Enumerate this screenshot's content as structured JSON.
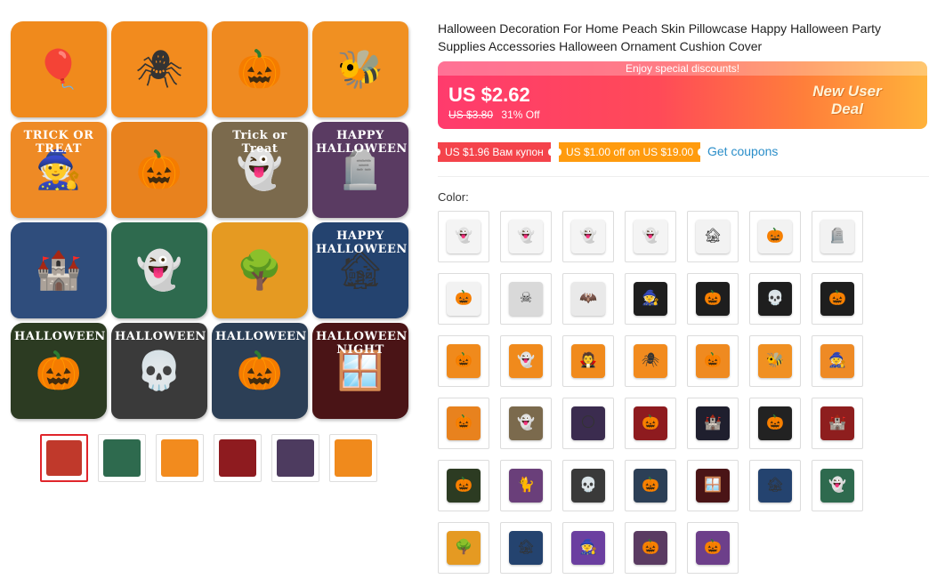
{
  "product": {
    "title": "Halloween Decoration For Home Peach Skin Pillowcase Happy Halloween Party Supplies Accessories Halloween Ornament Cushion Cover"
  },
  "price_banner": {
    "promo_strip": "Enjoy special discounts!",
    "current_price": "US $2.62",
    "original_price": "US $3.80",
    "discount": "31% Off",
    "new_user_line1": "New User",
    "new_user_line2": "Deal",
    "gradient_start": "#ff3b6d",
    "gradient_end": "#ffb23a"
  },
  "coupons": [
    {
      "text": "US $1.96 Вам купон",
      "color": "#f4434b"
    },
    {
      "text": "US $1.00 off on US $19.00",
      "color": "#ff9b0e"
    }
  ],
  "get_coupons_label": "Get coupons",
  "color_label": "Color:",
  "main_image": {
    "pillows": [
      {
        "icon": "pumpkin-balloon-icon",
        "glyph": "🎈",
        "text": "",
        "bg": "#f08a1c"
      },
      {
        "icon": "spider-icon",
        "glyph": "🕷",
        "text": "",
        "bg": "#f28b1e"
      },
      {
        "icon": "witch-hat-pumpkin-icon",
        "glyph": "🎃",
        "text": "",
        "bg": "#ef8a20"
      },
      {
        "icon": "bee-costume-icon",
        "glyph": "🐝",
        "text": "",
        "bg": "#f09022"
      },
      {
        "icon": "witch-hat-icon",
        "glyph": "🧙",
        "text": "TRICK OR TREAT",
        "bg": "#ee8a25"
      },
      {
        "icon": "smiling-pumpkin-icon",
        "glyph": "🎃",
        "text": "",
        "bg": "#e8821e"
      },
      {
        "icon": "ghost-icon",
        "glyph": "👻",
        "text": "Trick or Treat",
        "bg": "#7b6a4d"
      },
      {
        "icon": "happy-halloween-icon",
        "glyph": "🪦",
        "text": "HAPPY HALLOWEEN",
        "bg": "#5a3b62"
      },
      {
        "icon": "haunted-castle-icon",
        "glyph": "🏰",
        "text": "",
        "bg": "#2f4d7c"
      },
      {
        "icon": "graveyard-ghost-icon",
        "glyph": "👻",
        "text": "",
        "bg": "#2e6a4e"
      },
      {
        "icon": "spooky-tree-icon",
        "glyph": "🌳",
        "text": "",
        "bg": "#e59a22"
      },
      {
        "icon": "happy-halloween-house-icon",
        "glyph": "🏚",
        "text": "HAPPY HALLOWEEN",
        "bg": "#24436f"
      },
      {
        "icon": "scarecrow-icon",
        "glyph": "🎃",
        "text": "HALLOWEEN",
        "bg": "#2c3b22"
      },
      {
        "icon": "skull-hands-icon",
        "glyph": "💀",
        "text": "HALLOWEEN",
        "bg": "#3a3a3a"
      },
      {
        "icon": "pumpkin-tombstone-icon",
        "glyph": "🎃",
        "text": "HALLOWEEN",
        "bg": "#2c3f56"
      },
      {
        "icon": "halloween-night-window-icon",
        "glyph": "🪟",
        "text": "HALLOWEEN NIGHT",
        "bg": "#4a1416"
      }
    ]
  },
  "thumbnails": [
    {
      "icon": "collage-thumb-icon",
      "bg": "#c0392b",
      "active": true
    },
    {
      "icon": "graveyard-thumb-icon",
      "bg": "#2e6a4e",
      "active": false
    },
    {
      "icon": "spider-thumb-icon",
      "bg": "#f28b1e",
      "active": false
    },
    {
      "icon": "halloween-red-thumb-icon",
      "bg": "#8e1b1f",
      "active": false
    },
    {
      "icon": "moon-thumb-icon",
      "bg": "#4d3b5f",
      "active": false
    },
    {
      "icon": "ghost-witch-thumb-icon",
      "bg": "#f08a1c",
      "active": false
    }
  ],
  "swatches": [
    {
      "icon": "ghost-white-icon",
      "glyph": "👻",
      "bg": "#f4f4f4"
    },
    {
      "icon": "ghost-white-icon",
      "glyph": "👻",
      "bg": "#f4f4f4"
    },
    {
      "icon": "ghost-white-icon",
      "glyph": "👻",
      "bg": "#f4f4f4"
    },
    {
      "icon": "ghost-white-icon",
      "glyph": "👻",
      "bg": "#f4f4f4"
    },
    {
      "icon": "haunted-house-sketch-icon",
      "glyph": "🏚",
      "bg": "#f2f2f2"
    },
    {
      "icon": "pumpkin-sketch-icon",
      "glyph": "🎃",
      "bg": "#f2f2f2"
    },
    {
      "icon": "tombstone-sketch-icon",
      "glyph": "🪦",
      "bg": "#f2f2f2"
    },
    {
      "icon": "pumpkin-sketch-icon",
      "glyph": "🎃",
      "bg": "#f2f2f2"
    },
    {
      "icon": "pattern-black-white-icon",
      "glyph": "☠",
      "bg": "#d9d9d9"
    },
    {
      "icon": "bats-icon",
      "glyph": "🦇",
      "bg": "#e9e9e9"
    },
    {
      "icon": "witch-black-icon",
      "glyph": "🧙",
      "bg": "#1e1e1e"
    },
    {
      "icon": "pumpkin-black-icon",
      "glyph": "🎃",
      "bg": "#1e1e1e"
    },
    {
      "icon": "skull-black-icon",
      "glyph": "💀",
      "bg": "#1e1e1e"
    },
    {
      "icon": "happy-halloween-black-icon",
      "glyph": "🎃",
      "bg": "#1e1e1e"
    },
    {
      "icon": "pumpkin-balloon-icon",
      "glyph": "🎃",
      "bg": "#f08a1c"
    },
    {
      "icon": "ghost-witch-icon",
      "glyph": "👻",
      "bg": "#f08a1c"
    },
    {
      "icon": "vampire-icon",
      "glyph": "🧛",
      "bg": "#f08a1c"
    },
    {
      "icon": "spider-icon",
      "glyph": "🕷",
      "bg": "#f28b1e"
    },
    {
      "icon": "witch-hat-pumpkin-icon",
      "glyph": "🎃",
      "bg": "#ef8a20"
    },
    {
      "icon": "bee-costume-icon",
      "glyph": "🐝",
      "bg": "#f09022"
    },
    {
      "icon": "witch-hat-icon",
      "glyph": "🧙",
      "bg": "#ee8a25"
    },
    {
      "icon": "smiling-pumpkin-icon",
      "glyph": "🎃",
      "bg": "#e8821e"
    },
    {
      "icon": "ghost-icon",
      "glyph": "👻",
      "bg": "#7b6a4d"
    },
    {
      "icon": "moon-icon",
      "glyph": "🌕",
      "bg": "#3b2c4f"
    },
    {
      "icon": "halloween-red-icon",
      "glyph": "🎃",
      "bg": "#8e1b1f"
    },
    {
      "icon": "haunted-castle-icon",
      "glyph": "🏰",
      "bg": "#1f1f2e"
    },
    {
      "icon": "hello-halloween-icon",
      "glyph": "🎃",
      "bg": "#222222"
    },
    {
      "icon": "sunset-castle-icon",
      "glyph": "🏰",
      "bg": "#8e1e1e"
    },
    {
      "icon": "scarecrow-icon",
      "glyph": "🎃",
      "bg": "#2c3b22"
    },
    {
      "icon": "black-cat-icon",
      "glyph": "🐈",
      "bg": "#6a3f7a"
    },
    {
      "icon": "skull-hands-icon",
      "glyph": "💀",
      "bg": "#3a3a3a"
    },
    {
      "icon": "pumpkin-tombstone-icon",
      "glyph": "🎃",
      "bg": "#2c3f56"
    },
    {
      "icon": "halloween-night-window-icon",
      "glyph": "🪟",
      "bg": "#4a1416"
    },
    {
      "icon": "haunted-house-blue-icon",
      "glyph": "🏚",
      "bg": "#24436f"
    },
    {
      "icon": "graveyard-ghost-icon",
      "glyph": "👻",
      "bg": "#2e6a4e"
    },
    {
      "icon": "spooky-tree-icon",
      "glyph": "🌳",
      "bg": "#e59a22"
    },
    {
      "icon": "happy-halloween-house-icon",
      "glyph": "🏚",
      "bg": "#24436f"
    },
    {
      "icon": "witch-moon-purple-icon",
      "glyph": "🧙",
      "bg": "#6b3fa0"
    },
    {
      "icon": "happy-halloween-purple-icon",
      "glyph": "🎃",
      "bg": "#5a3b62"
    },
    {
      "icon": "pumpkin-purple-icon",
      "glyph": "🎃",
      "bg": "#6d3f8a"
    }
  ]
}
